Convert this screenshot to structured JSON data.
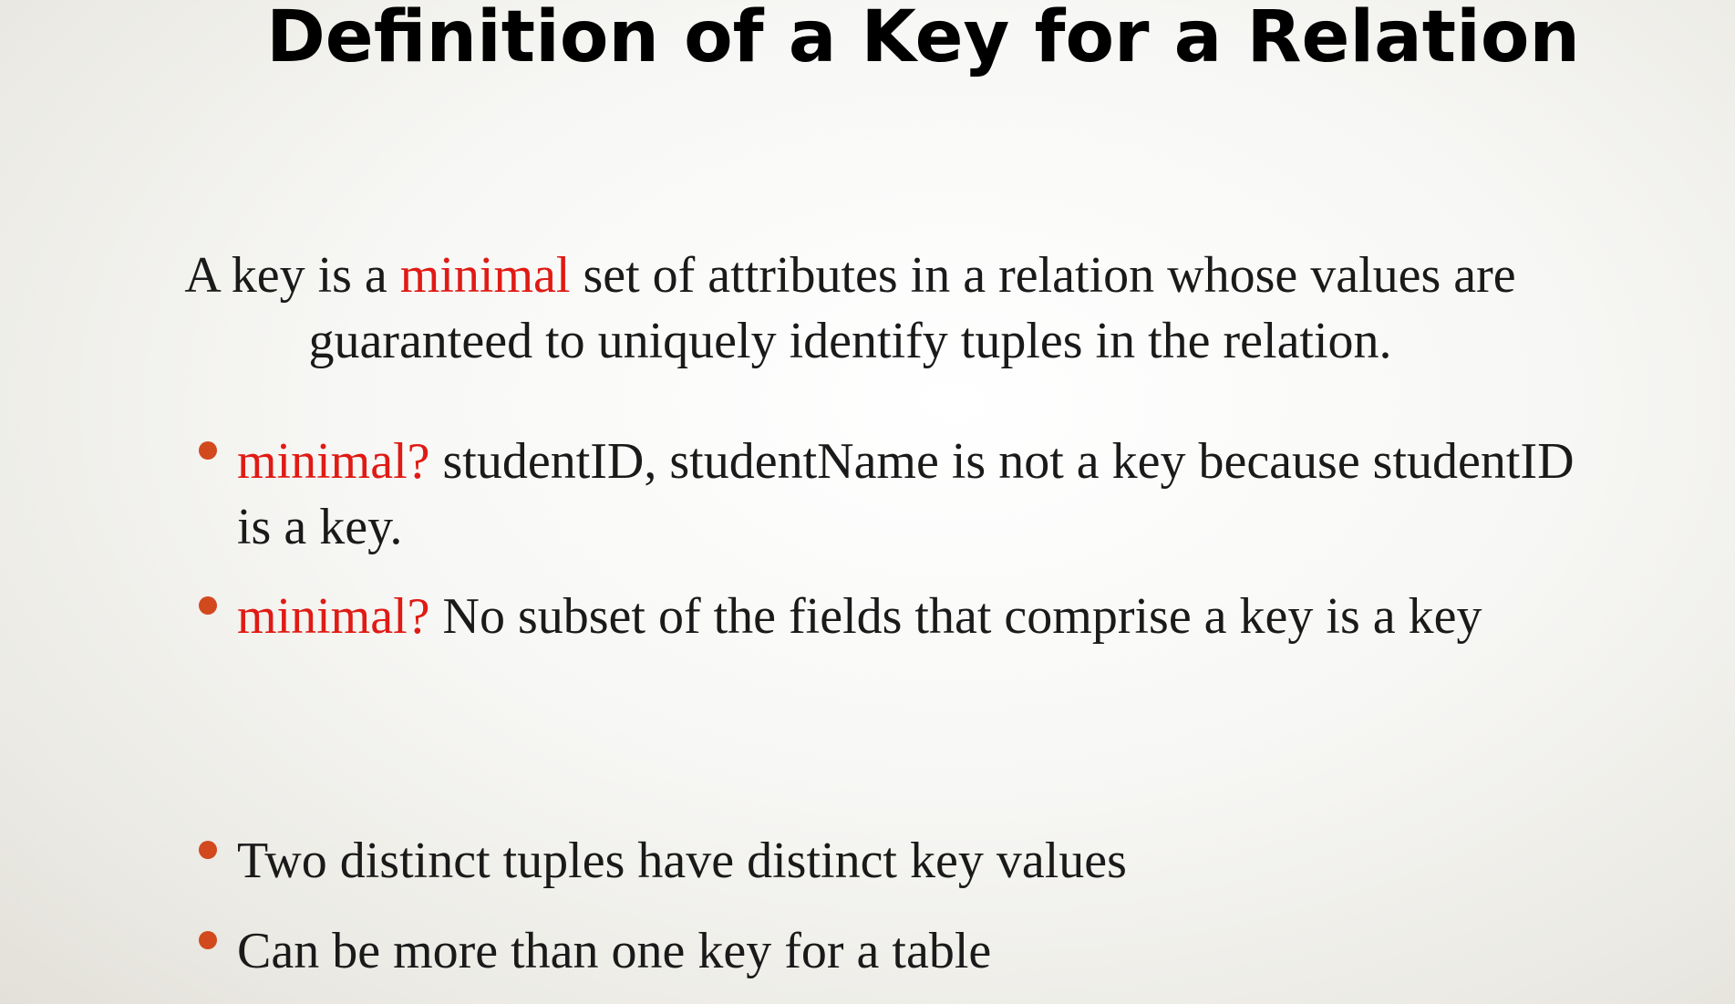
{
  "title": "Definition of a Key for a Relation",
  "definition": {
    "before": "A key is a ",
    "highlight": "minimal",
    "after": " set of attributes in a relation whose values are guaranteed to uniquely identify tuples in the relation."
  },
  "bullets": [
    {
      "highlight": "minimal?",
      "text": " studentID, studentName is not a key because studentID is a key."
    },
    {
      "highlight": "minimal?",
      "text": " No subset of the fields that comprise a key is a key"
    },
    {
      "highlight": "",
      "text": "Two distinct tuples have distinct key values"
    },
    {
      "highlight": "",
      "text": "Can be more than one key for a table"
    }
  ],
  "colors": {
    "accent": "#e01a14",
    "bullet": "#d2491e",
    "text": "#1a1a1a"
  }
}
